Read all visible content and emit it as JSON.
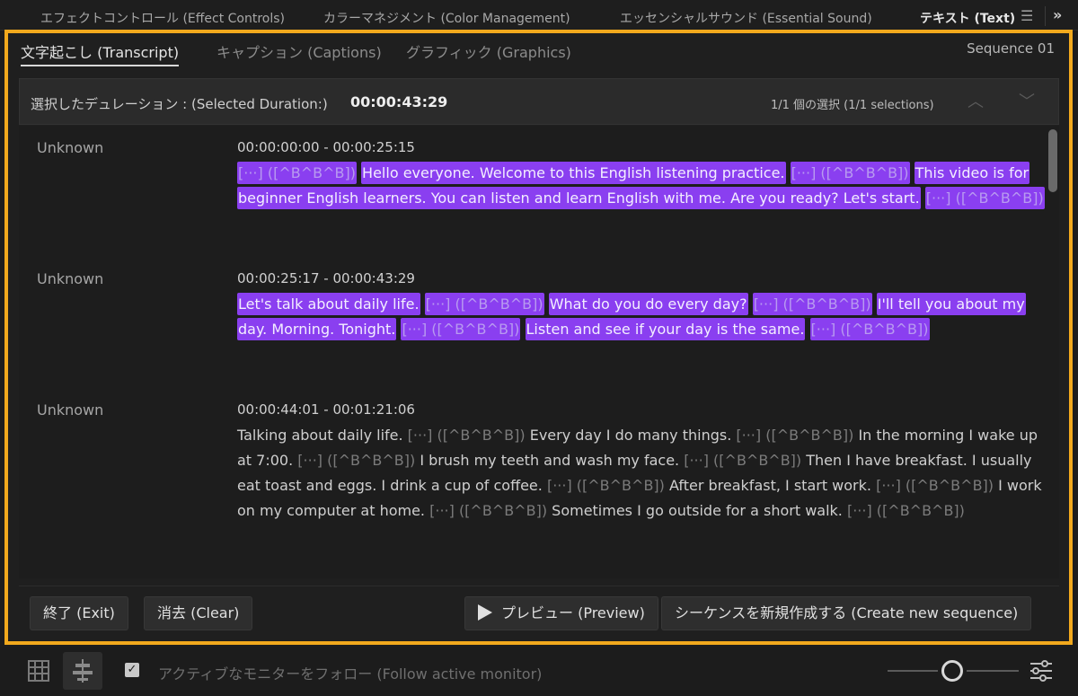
{
  "top_tabs": [
    {
      "label": "エフェクトコントロール (Effect Controls)"
    },
    {
      "label": "カラーマネジメント (Color Management)"
    },
    {
      "label": "エッセンシャルサウンド (Essential Sound)"
    },
    {
      "label": "テキスト (Text)"
    }
  ],
  "top_menu_icon": "hamburger-icon",
  "top_overflow_icon": "double-chevron-right-icon",
  "sub_tabs": [
    {
      "label": "文字起こし (Transcript)"
    },
    {
      "label": "キャプション (Captions)"
    },
    {
      "label": "グラフィック (Graphics)"
    }
  ],
  "sequence_name": "Sequence 01",
  "duration": {
    "label": "選択したデュレーション : (Selected Duration:)",
    "value": "00:00:43:29",
    "selection_count": "1/1 個の選択 (1/1 selections)"
  },
  "entries": [
    {
      "speaker": "Unknown",
      "time": "00:00:00:00 - 00:00:25:15",
      "highlighted": true,
      "segments": [
        {
          "t": "[···] ([^B^B^B])",
          "p": true
        },
        {
          "t": "Hello everyone. Welcome to this English listening practice."
        },
        {
          "t": "[···] ([^B^B^B])",
          "p": true
        },
        {
          "t": "This video is for beginner English learners. You can listen and learn English with me. Are you ready? Let's start."
        },
        {
          "t": "[···] ([^B^B^B])",
          "p": true
        }
      ]
    },
    {
      "speaker": "Unknown",
      "time": "00:00:25:17 - 00:00:43:29",
      "highlighted": true,
      "segments": [
        {
          "t": "Let's talk about daily life."
        },
        {
          "t": "[···] ([^B^B^B])",
          "p": true
        },
        {
          "t": "What do you do every day?"
        },
        {
          "t": "[···] ([^B^B^B])",
          "p": true
        },
        {
          "t": "I'll tell you about my day. Morning. Tonight."
        },
        {
          "t": "[···] ([^B^B^B])",
          "p": true
        },
        {
          "t": "Listen and see if your day is the same."
        },
        {
          "t": "[···] ([^B^B^B])",
          "p": true
        }
      ]
    },
    {
      "speaker": "Unknown",
      "time": "00:00:44:01 - 00:01:21:06",
      "highlighted": false,
      "segments": [
        {
          "t": "Talking about daily life."
        },
        {
          "t": "[···] ([^B^B^B])",
          "p": true
        },
        {
          "t": "Every day I do many things."
        },
        {
          "t": "[···] ([^B^B^B])",
          "p": true
        },
        {
          "t": "In the morning I wake up at 7:00."
        },
        {
          "t": "[···] ([^B^B^B])",
          "p": true
        },
        {
          "t": "I brush my teeth and wash my face."
        },
        {
          "t": "[···] ([^B^B^B])",
          "p": true
        },
        {
          "t": "Then I have breakfast. I usually eat toast and eggs. I drink a cup of coffee."
        },
        {
          "t": "[···] ([^B^B^B])",
          "p": true
        },
        {
          "t": "After breakfast, I start work."
        },
        {
          "t": "[···] ([^B^B^B])",
          "p": true
        },
        {
          "t": "I work on my computer at home."
        },
        {
          "t": "[···] ([^B^B^B])",
          "p": true
        },
        {
          "t": "Sometimes I go outside for a short walk."
        },
        {
          "t": "[···] ([^B^B^B])",
          "p": true
        }
      ]
    }
  ],
  "buttons": {
    "exit": "終了 (Exit)",
    "clear": "消去 (Clear)",
    "preview": "プレビュー (Preview)",
    "create_sequence": "シーケンスを新規作成する (Create new sequence)"
  },
  "bottom": {
    "follow_label": "アクティブなモニターをフォロー (Follow active monitor)",
    "follow_checked": true,
    "zoom_level": 0.5
  },
  "colors": {
    "highlight": "#8a3ff0",
    "panel_border": "#f2a91d"
  }
}
